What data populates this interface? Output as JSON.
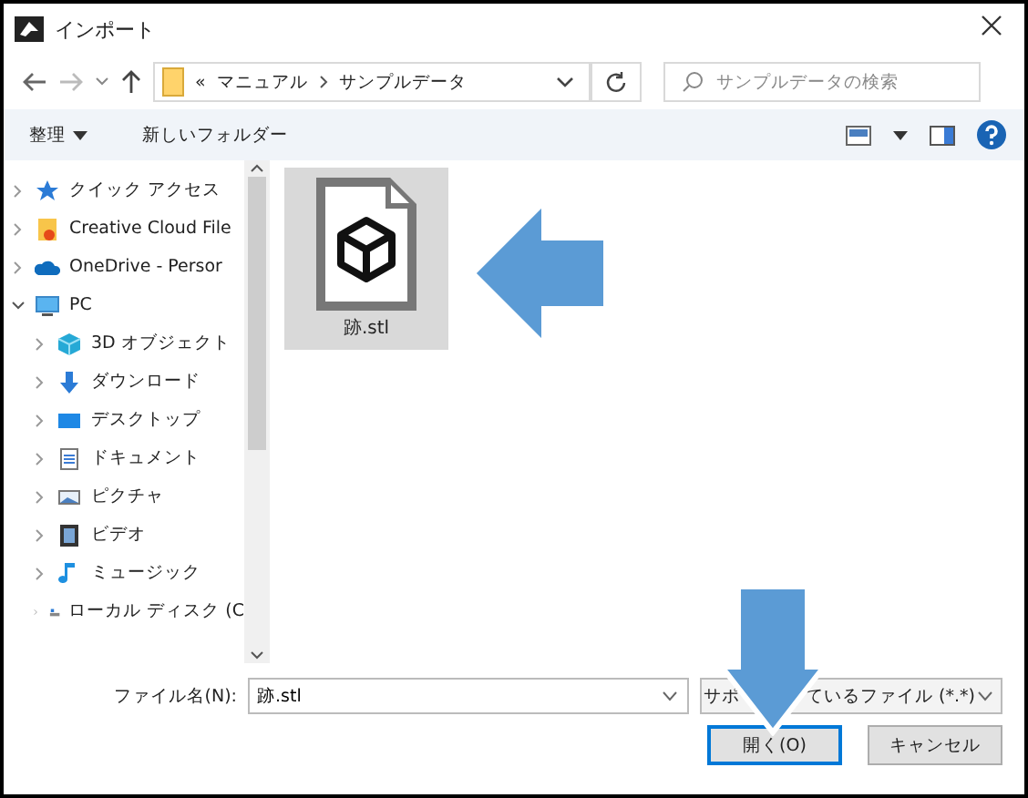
{
  "window": {
    "title": "インポート"
  },
  "address": {
    "overflow": "«",
    "path": [
      "マニュアル",
      "サンプルデータ"
    ]
  },
  "search": {
    "placeholder": "サンプルデータの検索"
  },
  "toolbar": {
    "organize": "整理",
    "new_folder": "新しいフォルダー"
  },
  "sidebar": {
    "items": [
      {
        "label": "クイック アクセス",
        "kind": "star",
        "expanded": false
      },
      {
        "label": "Creative Cloud File",
        "kind": "cloud-folder",
        "expanded": false
      },
      {
        "label": "OneDrive - Persor",
        "kind": "cloud",
        "expanded": false
      },
      {
        "label": "PC",
        "kind": "pc",
        "expanded": true,
        "children": [
          {
            "label": "3D オブジェクト",
            "kind": "cube",
            "expanded": false
          },
          {
            "label": "ダウンロード",
            "kind": "download",
            "expanded": false
          },
          {
            "label": "デスクトップ",
            "kind": "desktop",
            "expanded": false
          },
          {
            "label": "ドキュメント",
            "kind": "document",
            "expanded": false
          },
          {
            "label": "ピクチャ",
            "kind": "pictures",
            "expanded": false
          },
          {
            "label": "ビデオ",
            "kind": "video",
            "expanded": false
          },
          {
            "label": "ミュージック",
            "kind": "music",
            "expanded": false
          },
          {
            "label": "ローカル ディスク (C",
            "kind": "drive",
            "expanded": false
          }
        ]
      }
    ]
  },
  "files": [
    {
      "name": "跡.stl",
      "selected": true
    }
  ],
  "filename": {
    "label": "ファイル名(N):",
    "value": "跡.stl"
  },
  "filter": {
    "value_start": "サポ",
    "value_end": "ているファイル (*.*)"
  },
  "buttons": [
    {
      "label": "開く(O)",
      "kind": "primary"
    },
    {
      "label": "キャンセル",
      "kind": "secondary"
    }
  ]
}
